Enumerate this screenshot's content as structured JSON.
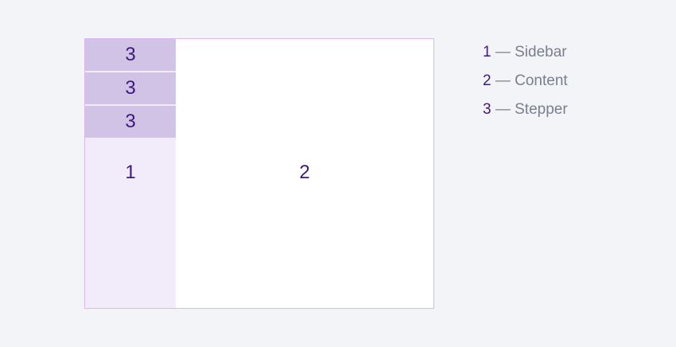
{
  "diagram": {
    "steppers": [
      "3",
      "3",
      "3"
    ],
    "sidebar_label": "1",
    "content_label": "2"
  },
  "legend": [
    {
      "num": "1",
      "text": " — Sidebar"
    },
    {
      "num": "2",
      "text": " — Content"
    },
    {
      "num": "3",
      "text": " — Stepper"
    }
  ],
  "colors": {
    "background": "#f3f4f8",
    "frame_border": "#d9b8f0",
    "sidebar": "#f1ebfa",
    "stepper": "#d0c3e5",
    "content": "#ffffff",
    "number": "#3d1a7a",
    "legend_text": "#7a7f8e"
  }
}
